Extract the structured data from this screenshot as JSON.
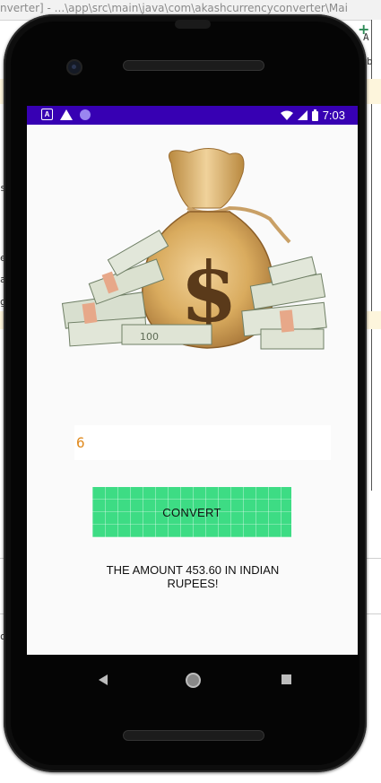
{
  "ide": {
    "path_text": "nverter] - ...\\app\\src\\main\\java\\com\\akashcurrencyconverter\\Mai",
    "fragments": [
      "b",
      "e",
      "a",
      "g",
      "s",
      "A",
      "o",
      "l"
    ]
  },
  "status_bar": {
    "time": "7:03",
    "icons": [
      "a-notification-icon",
      "warning-icon",
      "circle-notification-icon",
      "wifi-icon",
      "signal-icon",
      "battery-icon"
    ]
  },
  "app": {
    "image_label": "money-bag-illustration",
    "input": {
      "value": "6",
      "placeholder": ""
    },
    "convert_button_label": "CONVERT",
    "result_text": "THE AMOUNT  453.60 IN INDIAN RUPEES!"
  },
  "nav_bar": {
    "icons": [
      "back-icon",
      "home-icon",
      "recents-icon"
    ]
  },
  "colors": {
    "status_bar": "#3700b3",
    "button": "#3ddc84",
    "input_text": "#e08a1e"
  }
}
